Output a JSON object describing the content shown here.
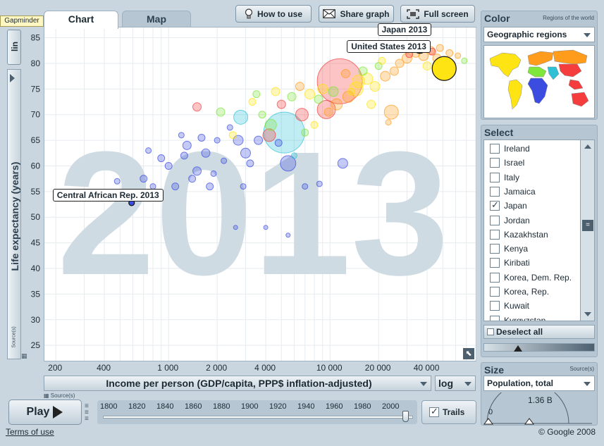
{
  "app": {
    "badge": "Gapminder",
    "terms": "Terms of use",
    "copyright": "© Google 2008"
  },
  "tabs": [
    {
      "label": "Chart",
      "active": true
    },
    {
      "label": "Map",
      "active": false
    }
  ],
  "toolbar": {
    "how_to_use": "How to use",
    "share_graph": "Share graph",
    "full_screen": "Full screen"
  },
  "y_scale_button": "lin",
  "source_label": "Source(s)",
  "x_axis": {
    "label": "Income per person (GDP/capita, PPP$ inflation-adjusted)",
    "scale": "log"
  },
  "color_panel": {
    "title": "Color",
    "subtitle": "Regions of the world",
    "selected": "Geographic regions"
  },
  "select_panel": {
    "title": "Select",
    "items": [
      {
        "label": "Ireland",
        "checked": false
      },
      {
        "label": "Israel",
        "checked": false
      },
      {
        "label": "Italy",
        "checked": false
      },
      {
        "label": "Jamaica",
        "checked": false
      },
      {
        "label": "Japan",
        "checked": true
      },
      {
        "label": "Jordan",
        "checked": false
      },
      {
        "label": "Kazakhstan",
        "checked": false
      },
      {
        "label": "Kenya",
        "checked": false
      },
      {
        "label": "Kiribati",
        "checked": false
      },
      {
        "label": "Korea, Dem. Rep.",
        "checked": false
      },
      {
        "label": "Korea, Rep.",
        "checked": false
      },
      {
        "label": "Kuwait",
        "checked": false
      },
      {
        "label": "Kyrgyzstan",
        "checked": false
      }
    ],
    "deselect_all": "Deselect all"
  },
  "size_panel": {
    "title": "Size",
    "source": "Source(s)",
    "selected": "Population, total",
    "min_label": "0",
    "max_label": "1.36 B"
  },
  "timeline": {
    "play_label": "Play",
    "trails_label": "Trails",
    "trails_checked": true,
    "years": [
      "1800",
      "1820",
      "1840",
      "1860",
      "1880",
      "1900",
      "1920",
      "1940",
      "1960",
      "1980",
      "2000"
    ],
    "current_year": "2013"
  },
  "colors": {
    "sub_saharan_africa": "#3a4de0",
    "south_asia": "#2fc0d6",
    "americas": "#ffe414",
    "east_asia_pacific": "#f53d3d",
    "europe_central_asia": "#ff9c1c",
    "middle_east_north_africa": "#7fe63a"
  },
  "chart_data": {
    "type": "scatter",
    "xlabel": "Income per person (GDP/capita, PPP$ inflation-adjusted)",
    "ylabel": "Life expectancy (years)",
    "xscale": "log",
    "xlim": [
      170,
      80000
    ],
    "ylim": [
      22,
      87
    ],
    "x_ticks": [
      {
        "value": 200,
        "label": "200"
      },
      {
        "value": 400,
        "label": "400"
      },
      {
        "value": 1000,
        "label": "1 000"
      },
      {
        "value": 2000,
        "label": "2 000"
      },
      {
        "value": 4000,
        "label": "4 000"
      },
      {
        "value": 10000,
        "label": "10 000"
      },
      {
        "value": 20000,
        "label": "20 000"
      },
      {
        "value": 40000,
        "label": "40 000"
      }
    ],
    "y_ticks": [
      25,
      30,
      35,
      40,
      45,
      50,
      55,
      60,
      65,
      70,
      75,
      80,
      85
    ],
    "background_year": "2013",
    "highlighted": [
      {
        "label": "Japan 2013",
        "x": 36000,
        "y": 83.2,
        "region": "east_asia_pacific"
      },
      {
        "label": "United States 2013",
        "x": 51000,
        "y": 79.0,
        "region": "americas"
      },
      {
        "label": "Central African Rep. 2013",
        "x": 590,
        "y": 52.8,
        "region": "sub_saharan_africa"
      }
    ],
    "points": [
      {
        "x": 5200,
        "y": 66.5,
        "r": 29,
        "region": "south_asia"
      },
      {
        "x": 11500,
        "y": 76.5,
        "r": 32,
        "region": "east_asia_pacific"
      },
      {
        "x": 51000,
        "y": 79.0,
        "r": 17,
        "region": "americas"
      },
      {
        "x": 36000,
        "y": 83.2,
        "r": 9,
        "region": "east_asia_pacific"
      },
      {
        "x": 590,
        "y": 52.8,
        "r": 4,
        "region": "sub_saharan_africa"
      },
      {
        "x": 5500,
        "y": 60.5,
        "r": 11,
        "region": "sub_saharan_africa"
      },
      {
        "x": 2800,
        "y": 69.5,
        "r": 10,
        "region": "south_asia"
      },
      {
        "x": 9500,
        "y": 71.0,
        "r": 13,
        "region": "east_asia_pacific"
      },
      {
        "x": 14500,
        "y": 75.0,
        "r": 10,
        "region": "americas"
      },
      {
        "x": 24000,
        "y": 70.5,
        "r": 10,
        "region": "europe_central_asia"
      },
      {
        "x": 6700,
        "y": 70.0,
        "r": 9,
        "region": "east_asia_pacific"
      },
      {
        "x": 4300,
        "y": 68.0,
        "r": 8,
        "region": "middle_east_north_africa"
      },
      {
        "x": 12000,
        "y": 60.5,
        "r": 7,
        "region": "sub_saharan_africa"
      },
      {
        "x": 2700,
        "y": 65.0,
        "r": 7,
        "region": "sub_saharan_africa"
      },
      {
        "x": 3000,
        "y": 62.5,
        "r": 7,
        "region": "sub_saharan_africa"
      },
      {
        "x": 1500,
        "y": 59.0,
        "r": 6,
        "region": "sub_saharan_africa"
      },
      {
        "x": 1700,
        "y": 62.5,
        "r": 6,
        "region": "sub_saharan_africa"
      },
      {
        "x": 1300,
        "y": 64.0,
        "r": 6,
        "region": "sub_saharan_africa"
      },
      {
        "x": 1800,
        "y": 56.0,
        "r": 5,
        "region": "sub_saharan_africa"
      },
      {
        "x": 1400,
        "y": 57.5,
        "r": 5,
        "region": "sub_saharan_africa"
      },
      {
        "x": 900,
        "y": 61.5,
        "r": 5,
        "region": "sub_saharan_africa"
      },
      {
        "x": 700,
        "y": 57.5,
        "r": 5,
        "region": "sub_saharan_africa"
      },
      {
        "x": 800,
        "y": 56.0,
        "r": 4,
        "region": "sub_saharan_africa"
      },
      {
        "x": 1100,
        "y": 56.0,
        "r": 5,
        "region": "sub_saharan_africa"
      },
      {
        "x": 1900,
        "y": 58.5,
        "r": 4,
        "region": "sub_saharan_africa"
      },
      {
        "x": 2200,
        "y": 61.0,
        "r": 4,
        "region": "sub_saharan_africa"
      },
      {
        "x": 3200,
        "y": 60.5,
        "r": 5,
        "region": "sub_saharan_africa"
      },
      {
        "x": 3600,
        "y": 65.0,
        "r": 6,
        "region": "sub_saharan_africa"
      },
      {
        "x": 4800,
        "y": 64.5,
        "r": 5,
        "region": "sub_saharan_africa"
      },
      {
        "x": 1600,
        "y": 65.5,
        "r": 5,
        "region": "sub_saharan_africa"
      },
      {
        "x": 1200,
        "y": 66.0,
        "r": 4,
        "region": "sub_saharan_africa"
      },
      {
        "x": 2400,
        "y": 67.5,
        "r": 4,
        "region": "sub_saharan_africa"
      },
      {
        "x": 1500,
        "y": 71.5,
        "r": 6,
        "region": "east_asia_pacific"
      },
      {
        "x": 2100,
        "y": 70.5,
        "r": 6,
        "region": "middle_east_north_africa"
      },
      {
        "x": 2500,
        "y": 66.0,
        "r": 5,
        "region": "americas"
      },
      {
        "x": 3300,
        "y": 72.5,
        "r": 5,
        "region": "americas"
      },
      {
        "x": 3800,
        "y": 70.0,
        "r": 5,
        "region": "middle_east_north_africa"
      },
      {
        "x": 4600,
        "y": 74.5,
        "r": 6,
        "region": "americas"
      },
      {
        "x": 5800,
        "y": 73.5,
        "r": 6,
        "region": "middle_east_north_africa"
      },
      {
        "x": 6500,
        "y": 75.5,
        "r": 6,
        "region": "europe_central_asia"
      },
      {
        "x": 7500,
        "y": 74.0,
        "r": 7,
        "region": "americas"
      },
      {
        "x": 8500,
        "y": 73.0,
        "r": 6,
        "region": "middle_east_north_africa"
      },
      {
        "x": 9000,
        "y": 75.0,
        "r": 7,
        "region": "americas"
      },
      {
        "x": 10500,
        "y": 74.5,
        "r": 7,
        "region": "middle_east_north_africa"
      },
      {
        "x": 13000,
        "y": 73.5,
        "r": 8,
        "region": "europe_central_asia"
      },
      {
        "x": 15000,
        "y": 76.5,
        "r": 9,
        "region": "americas"
      },
      {
        "x": 17000,
        "y": 77.0,
        "r": 8,
        "region": "americas"
      },
      {
        "x": 19000,
        "y": 75.5,
        "r": 7,
        "region": "americas"
      },
      {
        "x": 22000,
        "y": 77.5,
        "r": 7,
        "region": "europe_central_asia"
      },
      {
        "x": 25000,
        "y": 78.5,
        "r": 6,
        "region": "europe_central_asia"
      },
      {
        "x": 27000,
        "y": 80.0,
        "r": 6,
        "region": "europe_central_asia"
      },
      {
        "x": 30000,
        "y": 81.0,
        "r": 7,
        "region": "europe_central_asia"
      },
      {
        "x": 34000,
        "y": 82.0,
        "r": 6,
        "region": "europe_central_asia"
      },
      {
        "x": 38000,
        "y": 81.5,
        "r": 7,
        "region": "europe_central_asia"
      },
      {
        "x": 42000,
        "y": 82.5,
        "r": 6,
        "region": "europe_central_asia"
      },
      {
        "x": 46000,
        "y": 81.0,
        "r": 6,
        "region": "europe_central_asia"
      },
      {
        "x": 48000,
        "y": 83.0,
        "r": 5,
        "region": "europe_central_asia"
      },
      {
        "x": 55000,
        "y": 82.0,
        "r": 5,
        "region": "europe_central_asia"
      },
      {
        "x": 62000,
        "y": 81.5,
        "r": 4,
        "region": "europe_central_asia"
      },
      {
        "x": 68000,
        "y": 80.5,
        "r": 4,
        "region": "middle_east_north_africa"
      },
      {
        "x": 43000,
        "y": 82.3,
        "r": 5,
        "region": "east_asia_pacific"
      },
      {
        "x": 31000,
        "y": 81.8,
        "r": 5,
        "region": "east_asia_pacific"
      },
      {
        "x": 20000,
        "y": 79.5,
        "r": 5,
        "region": "middle_east_north_africa"
      },
      {
        "x": 16000,
        "y": 78.5,
        "r": 6,
        "region": "middle_east_north_africa"
      },
      {
        "x": 12500,
        "y": 78.0,
        "r": 6,
        "region": "europe_central_asia"
      },
      {
        "x": 9800,
        "y": 70.5,
        "r": 6,
        "region": "europe_central_asia"
      },
      {
        "x": 11000,
        "y": 72.0,
        "r": 8,
        "region": "europe_central_asia"
      },
      {
        "x": 18000,
        "y": 72.0,
        "r": 6,
        "region": "americas"
      },
      {
        "x": 23000,
        "y": 68.5,
        "r": 4,
        "region": "europe_central_asia"
      },
      {
        "x": 6000,
        "y": 62.0,
        "r": 4,
        "region": "south_asia"
      },
      {
        "x": 4200,
        "y": 66.0,
        "r": 9,
        "region": "east_asia_pacific"
      },
      {
        "x": 5000,
        "y": 72.0,
        "r": 6,
        "region": "east_asia_pacific"
      },
      {
        "x": 3500,
        "y": 74.0,
        "r": 5,
        "region": "middle_east_north_africa"
      },
      {
        "x": 7000,
        "y": 66.5,
        "r": 5,
        "region": "middle_east_north_africa"
      },
      {
        "x": 7000,
        "y": 56.0,
        "r": 4,
        "region": "sub_saharan_africa"
      },
      {
        "x": 2900,
        "y": 56.0,
        "r": 4,
        "region": "sub_saharan_africa"
      },
      {
        "x": 8600,
        "y": 56.5,
        "r": 4,
        "region": "sub_saharan_africa"
      },
      {
        "x": 4000,
        "y": 48.0,
        "r": 3,
        "region": "sub_saharan_africa"
      },
      {
        "x": 5500,
        "y": 46.5,
        "r": 3,
        "region": "sub_saharan_africa"
      },
      {
        "x": 750,
        "y": 63.0,
        "r": 4,
        "region": "sub_saharan_africa"
      },
      {
        "x": 1000,
        "y": 60.0,
        "r": 5,
        "region": "sub_saharan_africa"
      },
      {
        "x": 1250,
        "y": 62.0,
        "r": 5,
        "region": "sub_saharan_africa"
      },
      {
        "x": 2000,
        "y": 65.0,
        "r": 4,
        "region": "sub_saharan_africa"
      },
      {
        "x": 480,
        "y": 57.0,
        "r": 4,
        "region": "sub_saharan_africa"
      },
      {
        "x": 2600,
        "y": 48.0,
        "r": 3,
        "region": "sub_saharan_africa"
      },
      {
        "x": 8000,
        "y": 68.0,
        "r": 5,
        "region": "americas"
      },
      {
        "x": 13500,
        "y": 74.5,
        "r": 5,
        "region": "americas"
      },
      {
        "x": 40000,
        "y": 79.5,
        "r": 6,
        "region": "americas"
      },
      {
        "x": 21000,
        "y": 80.5,
        "r": 5,
        "region": "americas"
      }
    ]
  }
}
